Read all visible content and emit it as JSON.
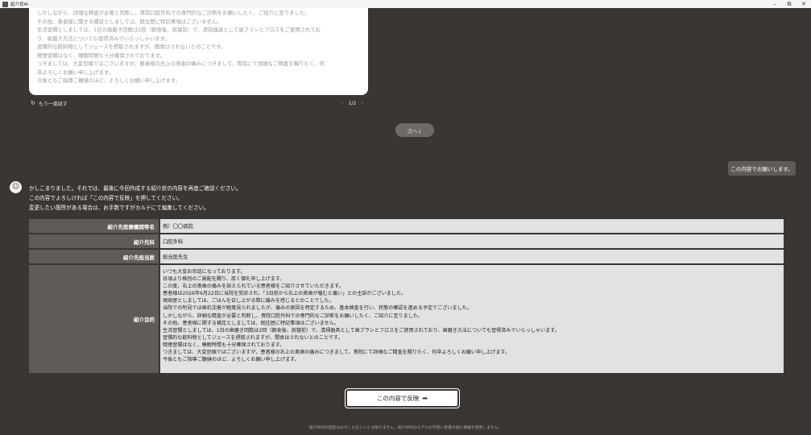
{
  "window": {
    "title": "紹介状AI",
    "controls": [
      "minimize-icon",
      "restore-icon",
      "close-icon"
    ]
  },
  "previous_answer": {
    "lines": [
      "しかしながら、詳細な精査が必要と判断し、貴院口腔外科での専門的なご診断をお願いしたく、ご紹介に至りました。",
      "その他、患者様に関する補足としましては、既往歴に特記事項はございません。",
      "生活習慣としましては、1日の歯磨き回数は2回（朝食後、就寝前）で、清掃器具として歯ブラシとフロスをご使用されてお",
      "り、歯磨き方法についても習得済みでいらっしゃいます。",
      "習慣的な飲料物としてジュースを摂取されますが、間食はされないとのことです。",
      "喫煙習慣はなく、睡眠時間も十分確保されております。",
      "つきましては、大変恐縮ではございますが、患者様の右上の奥歯の痛みにつきまして、貴院にて詳細なご精査を賜りたく、何",
      "卒よろしくお願い申し上げます。",
      "今後ともご指導ご鞭撻のほど、よろしくお願い申し上げます。"
    ],
    "retry_icon": "refresh-icon",
    "retry_label": "もう一度試す",
    "pager": "1/2"
  },
  "next_button": "次へ↓",
  "user_message": "この内容でお願いします。",
  "bot": {
    "avatar_icon": "robot-icon",
    "lines": [
      "かしこまりました。それでは、最後に今回作成する紹介状の内容を再度ご確認ください。",
      "この内容でよろしければ「この内容で反映」を押してください。",
      "変更したい箇所がある場合は、お手数ですがカルテにて編集してください。"
    ]
  },
  "referral": {
    "rows": [
      {
        "label": "紹介先医療機関等名",
        "value": "例）〇〇病院"
      },
      {
        "label": "紹介先科",
        "value": "口腔外科"
      },
      {
        "label": "紹介先担当医",
        "value": "担当医先生"
      }
    ],
    "purpose_label": "紹介目的",
    "purpose_lines": [
      "いつも大変お世話になっております。",
      "日頃より格別のご高配を賜り、厚く御礼申し上げます。",
      "この度、右上の奥歯の痛みを訴えられている患者様をご紹介させていただきます。",
      "患者様は2026年6月22日に当院を受診され、「3日前から右上の奥歯が噛むと痛い」との主訴がございました。",
      "現病歴としましては、ごはんを召し上がる際に痛みを感じるとのことでした。",
      "当院での所見では歯石沈着が軽度見られましたが、痛みの原因を特定するため、基本検査を行い、状態の確認を進める予定でございました。",
      "しかしながら、詳細な精査が必要と判断し、貴院口腔外科での専門的なご診断をお願いしたく、ご紹介に至りました。",
      "その他、患者様に関する補足としましては、既往歴に特記事項はございません。",
      "生活習慣としましては、1日の歯磨き回数は2回（朝食後、就寝前）で、清掃器具として歯ブラシとフロスをご使用されており、歯磨き方法についても習得済みでいらっしゃいます。",
      "習慣的な飲料物としてジュースを摂取されますが、間食はされないとのことです。",
      "喫煙習慣はなく、睡眠時間も十分確保されております。",
      "つきましては、大変恐縮ではございますが、患者様の右上の奥歯の痛みにつきまして、貴院にて詳細なご精査を賜りたく、何卒よろしくお願い申し上げます。",
      "今後ともご指導ご鞭撻のほど、よろしくお願い申し上げます。"
    ]
  },
  "apply_button": {
    "label": "この内容で反映",
    "icon": "share-arrow-icon"
  },
  "disclaimer": "紹介状AIの回答は必ずしも正しいとは限りません。紹介状AIはモデルの学習に患者の個人情報を使用しません。"
}
